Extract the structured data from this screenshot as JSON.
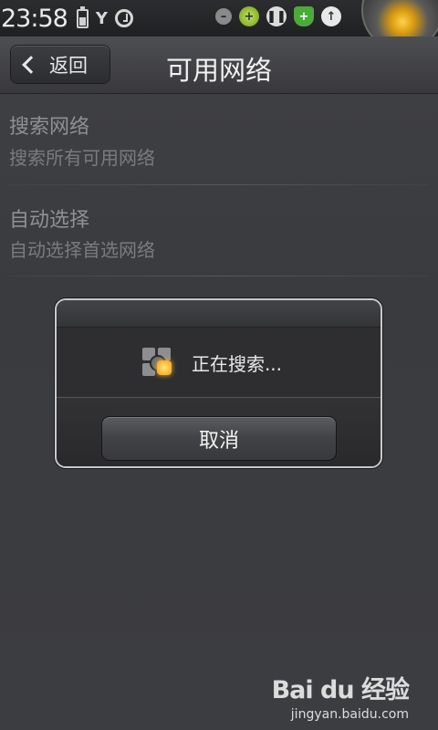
{
  "statusbar": {
    "time": "23:58",
    "signal_glyph": "Y",
    "icons": [
      "battery-icon",
      "signal-icon",
      "alarm-icon",
      "notification-dot-icon",
      "plus-icon",
      "pause-icon",
      "shield-icon",
      "upload-arrow-icon"
    ]
  },
  "titlebar": {
    "back_label": "返回",
    "title": "可用网络"
  },
  "list": [
    {
      "title": "搜索网络",
      "subtitle": "搜索所有可用网络"
    },
    {
      "title": "自动选择",
      "subtitle": "自动选择首选网络"
    }
  ],
  "dialog": {
    "message": "正在搜索...",
    "cancel_label": "取消"
  },
  "watermark": {
    "logo": "Bai du 经验",
    "url": "jingyan.baidu.com"
  },
  "colors": {
    "background": "#3b3c40",
    "dialog_border": "#c9c9cc",
    "accent_glow": "#f0a010"
  }
}
